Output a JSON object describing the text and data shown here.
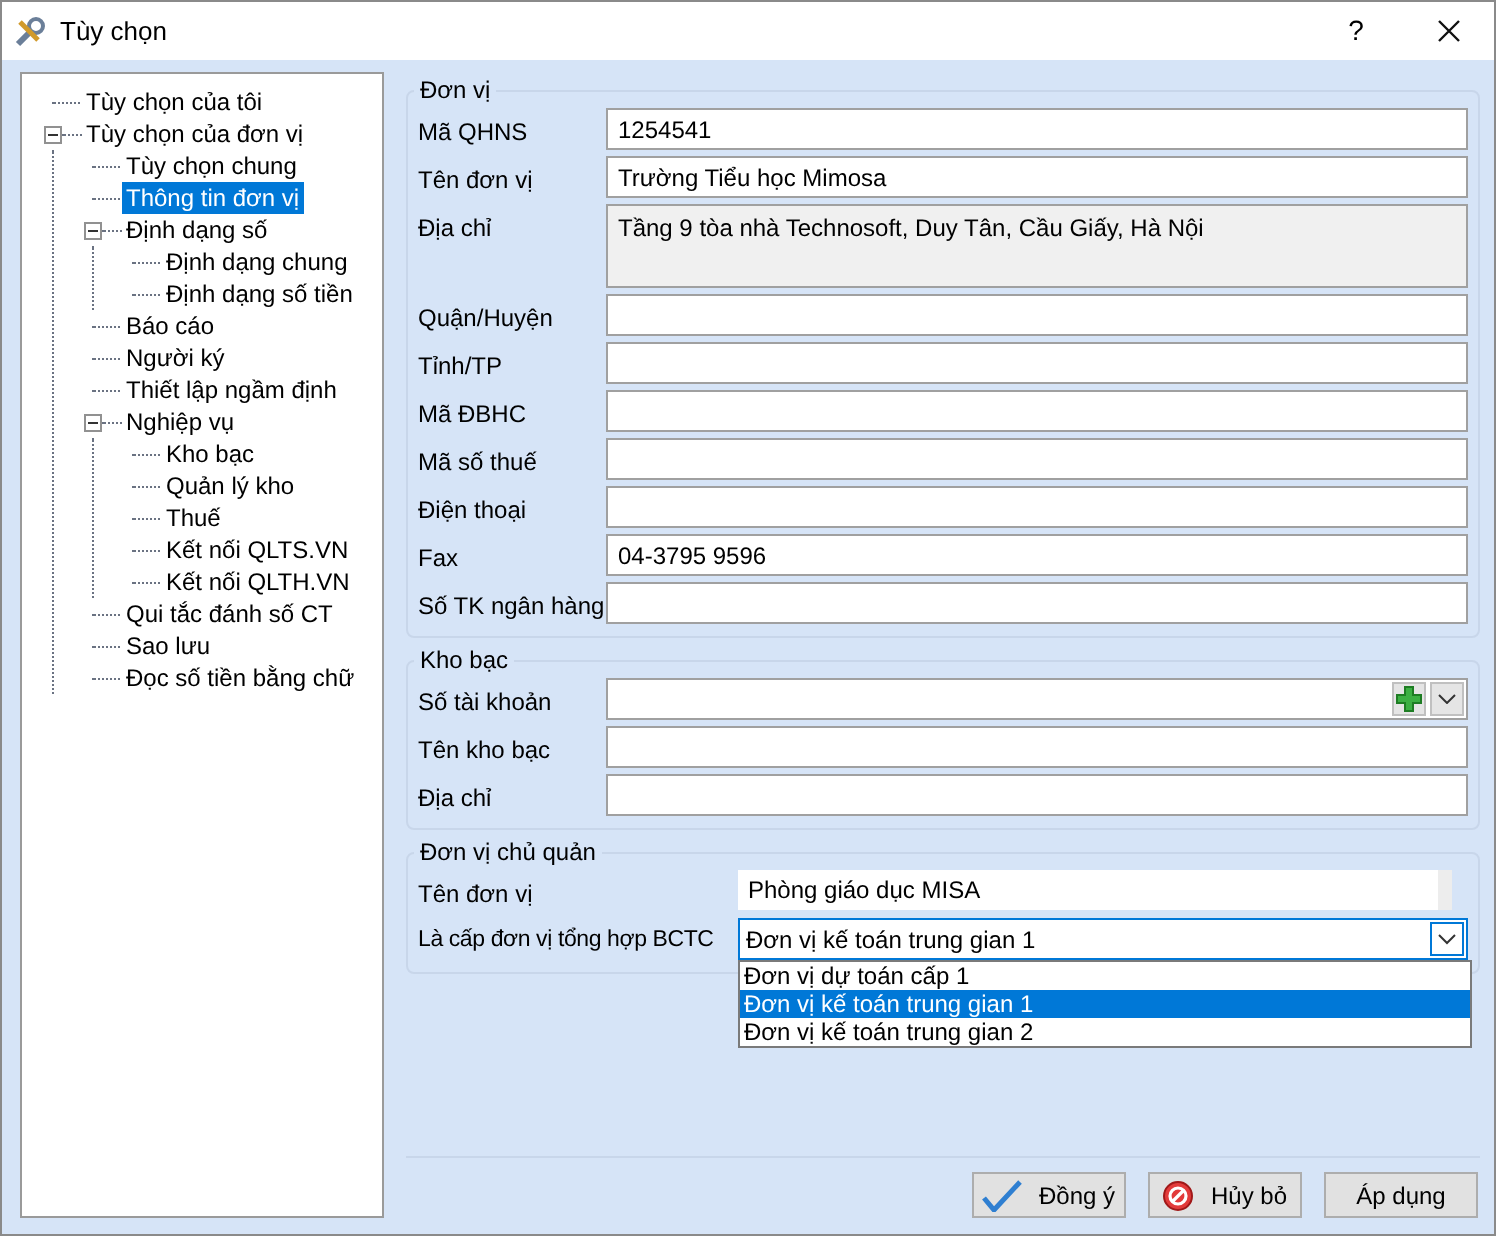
{
  "window": {
    "title": "Tùy chọn",
    "help": "?"
  },
  "tree": [
    {
      "label": "Tùy chọn của tôi",
      "selected": false
    },
    {
      "label": "Tùy chọn của đơn vị",
      "selected": false,
      "expanded": true,
      "children": [
        {
          "label": "Tùy chọn chung",
          "selected": false
        },
        {
          "label": "Thông tin đơn vị",
          "selected": true
        },
        {
          "label": "Định dạng số",
          "selected": false,
          "expanded": true,
          "children": [
            {
              "label": "Định dạng chung",
              "selected": false
            },
            {
              "label": "Định dạng số tiền",
              "selected": false
            }
          ]
        },
        {
          "label": "Báo cáo",
          "selected": false
        },
        {
          "label": "Người ký",
          "selected": false
        },
        {
          "label": "Thiết lập ngầm định",
          "selected": false
        },
        {
          "label": "Nghiệp vụ",
          "selected": false,
          "expanded": true,
          "children": [
            {
              "label": "Kho bạc",
              "selected": false
            },
            {
              "label": "Quản lý kho",
              "selected": false
            },
            {
              "label": "Thuế",
              "selected": false
            },
            {
              "label": "Kết nối QLTS.VN",
              "selected": false
            },
            {
              "label": "Kết nối QLTH.VN",
              "selected": false
            }
          ]
        },
        {
          "label": "Qui tắc đánh số CT",
          "selected": false
        },
        {
          "label": "Sao lưu",
          "selected": false
        },
        {
          "label": "Đọc số tiền bằng chữ",
          "selected": false
        }
      ]
    }
  ],
  "unit": {
    "title": "Đơn vị",
    "fields": [
      {
        "label": "Mã QHNS",
        "value": "1254541",
        "kind": "text",
        "readonly": false
      },
      {
        "label": "Tên đơn vị",
        "value": "Trường Tiểu học Mimosa",
        "kind": "text",
        "readonly": false
      },
      {
        "label": "Địa chỉ",
        "value": "Tầng 9 tòa nhà Technosoft, Duy Tân, Cầu Giấy, Hà Nội",
        "kind": "multiline",
        "readonly": true
      },
      {
        "label": "Quận/Huyện",
        "kind": "text",
        "readonly": false
      },
      {
        "label": "Tỉnh/TP",
        "kind": "text",
        "readonly": false
      },
      {
        "label": "Mã ĐBHC",
        "kind": "text",
        "readonly": false
      },
      {
        "label": "Mã số thuế",
        "kind": "text",
        "readonly": false
      },
      {
        "label": "Điện thoại",
        "kind": "text",
        "readonly": false
      },
      {
        "label": "Fax",
        "value": "04-3795 9596",
        "kind": "text",
        "readonly": false
      },
      {
        "label": "Số TK ngân hàng",
        "kind": "text",
        "readonly": false
      }
    ]
  },
  "treasury": {
    "title": "Kho bạc",
    "fields": [
      {
        "label": "Số tài khoản",
        "kind": "combo-add",
        "readonly": false
      },
      {
        "label": "Tên kho bạc",
        "kind": "text",
        "readonly": false
      },
      {
        "label": "Địa chỉ",
        "kind": "text",
        "readonly": false
      }
    ]
  },
  "parent_unit": {
    "title": "Đơn vị chủ quản",
    "name": {
      "label": "Tên đơn vị",
      "value": "Phòng giáo dục MISA"
    },
    "level": {
      "label": "Là cấp đơn vị tổng hợp BCTC",
      "value": "Đơn vị kế toán trung gian 1",
      "expanded": true,
      "options": [
        {
          "label": "Đơn vị dự toán cấp 1",
          "selected": false
        },
        {
          "label": "Đơn vị kế toán trung gian 1",
          "selected": true
        },
        {
          "label": "Đơn vị kế toán trung gian 2",
          "selected": false
        }
      ]
    }
  },
  "buttons": [
    {
      "label": "Đồng ý",
      "kind": "ok"
    },
    {
      "label": "Hủy bỏ",
      "kind": "cancel"
    },
    {
      "label": "Áp dụng",
      "kind": "plain"
    }
  ]
}
